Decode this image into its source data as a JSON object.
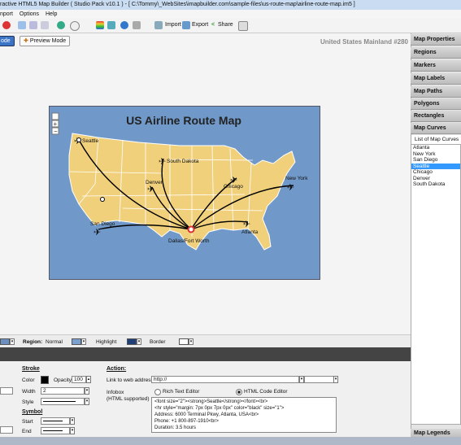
{
  "window": {
    "title": "ractive HTML5 Map Builder ( Studio Pack v10.1 ) - [ C:\\Tommy\\_WebSites\\imapbuilder.com\\sample-files\\us-route-map\\airline-route-map.im5 ]"
  },
  "menu": [
    "nport",
    "Options",
    "Help"
  ],
  "toolbar": {
    "import_label": "Import",
    "export_label": "Export",
    "share_label": "Share"
  },
  "modes": {
    "design_label": "ode",
    "preview_label": "Preview Mode"
  },
  "map_header": "United States Mainland #280",
  "map": {
    "title": "US Airline Route Map",
    "cities": [
      "Seattle",
      "South Dakota",
      "Denver",
      "Chicago",
      "New York",
      "San Diego",
      "Atlanta",
      "Dallas/Fort Worth"
    ]
  },
  "right_panel": {
    "sections": [
      "Map Properties",
      "Regions",
      "Markers",
      "Map Labels",
      "Map Paths",
      "Polygons",
      "Rectangles",
      "Map Curves"
    ],
    "list_title": "List of Map Curves",
    "curves": [
      "Atlanta",
      "New York",
      "San Diego",
      "Seattle",
      "Chicago",
      "Denver",
      "South Dakota"
    ],
    "selected_curve": "Seattle",
    "bottom_section": "Map Legends"
  },
  "region_bar": {
    "region_label": "Region:",
    "normal_label": "Normal",
    "highlight_label": "Highlight",
    "border_label": "Border"
  },
  "properties": {
    "stroke_heading": "Stroke",
    "color_label": "Color",
    "opacity_label": "Opacity",
    "opacity_value": "100",
    "width_label": "Width",
    "width_value": "2",
    "style_label": "Style",
    "symbol_heading": "Symbol",
    "start_label": "Start",
    "end_label": "End",
    "action_heading": "Action:",
    "link_label": "Link to web address",
    "link_value": "http://",
    "infobox_label": "Infobox",
    "infobox_sub": "(HTML supported)",
    "rich_text_label": "Rich Text Editor",
    "html_code_label": "HTML Code Editor",
    "html_lines": [
      "<font size=\"2\"><strong>Seattle</strong></font><br>",
      "<hr style=\"margin: 7px 0px 7px 0px\" color=\"black\" size=\"1\">",
      "Address: 6000 Terminal Pkwy, Atlanta, USA<br>",
      "Phone: +1 800-897-1910<br>",
      "Duration: 3.5 hours"
    ]
  },
  "colors": {
    "ocean": "#7099c9",
    "land": "#f1d07c",
    "accent": "#3399ff",
    "route": "#000000",
    "hub": "#e03030"
  }
}
